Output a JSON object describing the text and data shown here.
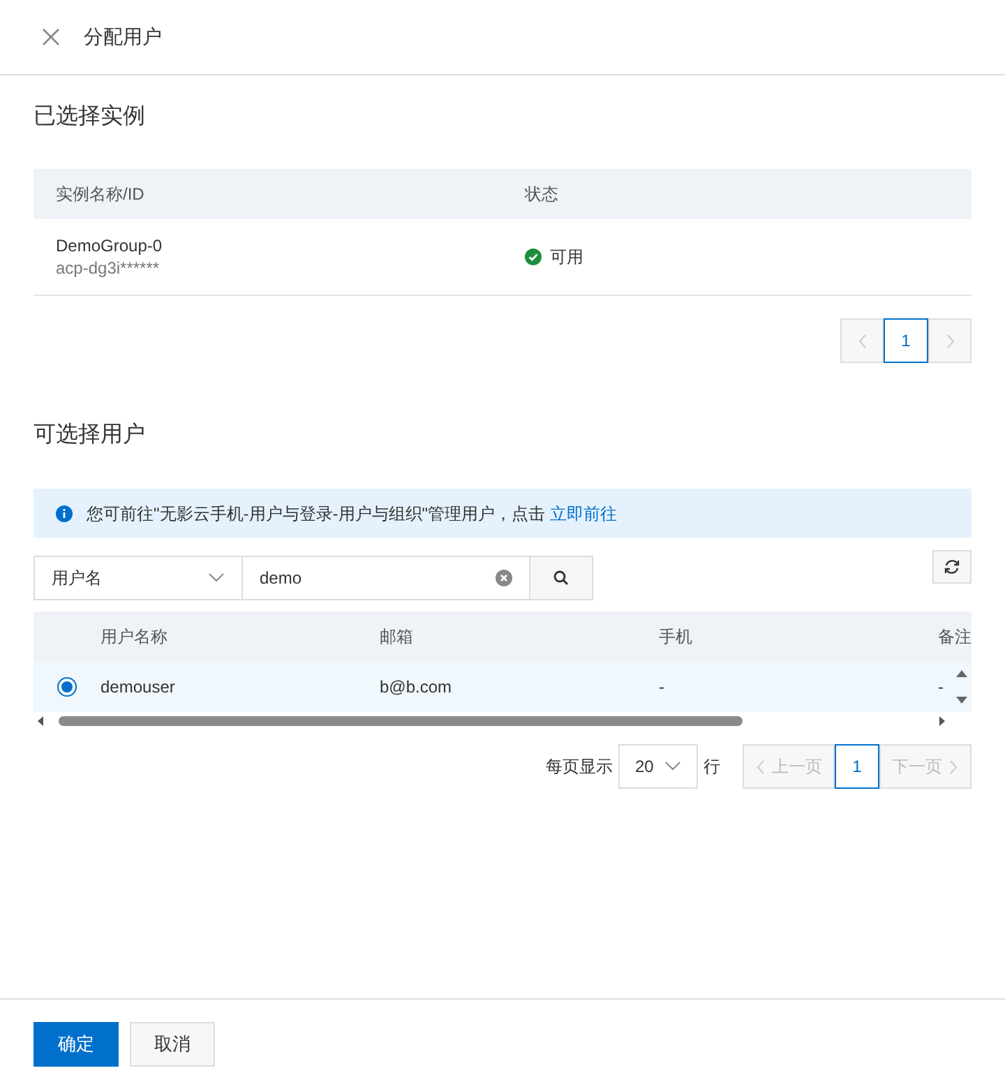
{
  "header": {
    "title": "分配用户"
  },
  "selected_instances": {
    "title": "已选择实例",
    "columns": [
      "实例名称/ID",
      "状态"
    ],
    "rows": [
      {
        "name": "DemoGroup-0",
        "id": "acp-dg3i******",
        "status": {
          "text": "可用",
          "kind": "ok"
        }
      }
    ],
    "pager": {
      "prev": {
        "disabled": true
      },
      "pages": [
        {
          "label": "1",
          "selected": true
        }
      ],
      "next": {
        "disabled": true
      }
    }
  },
  "available_users": {
    "title": "可选择用户",
    "notice": {
      "text": "您可前往\"无影云手机-用户与登录-用户与组织\"管理用户，点击",
      "link": "立即前往"
    },
    "search": {
      "field": "用户名",
      "value": "demo"
    },
    "columns": [
      "用户名称",
      "邮箱",
      "手机",
      "备注"
    ],
    "rows": [
      {
        "selected": true,
        "cells": [
          "demouser",
          "b@b.com",
          "-",
          "-"
        ]
      }
    ],
    "page_size": {
      "label": "每页显示",
      "value": "20",
      "unit": "行"
    },
    "pager": {
      "prev": {
        "label": "上一页",
        "disabled": true
      },
      "pages": [
        {
          "label": "1",
          "selected": true
        }
      ],
      "next": {
        "label": "下一页",
        "disabled": true
      }
    }
  },
  "footer": {
    "buttons": [
      {
        "label": "确定",
        "kind": "primary"
      },
      {
        "label": "取消",
        "kind": "secondary"
      }
    ]
  }
}
